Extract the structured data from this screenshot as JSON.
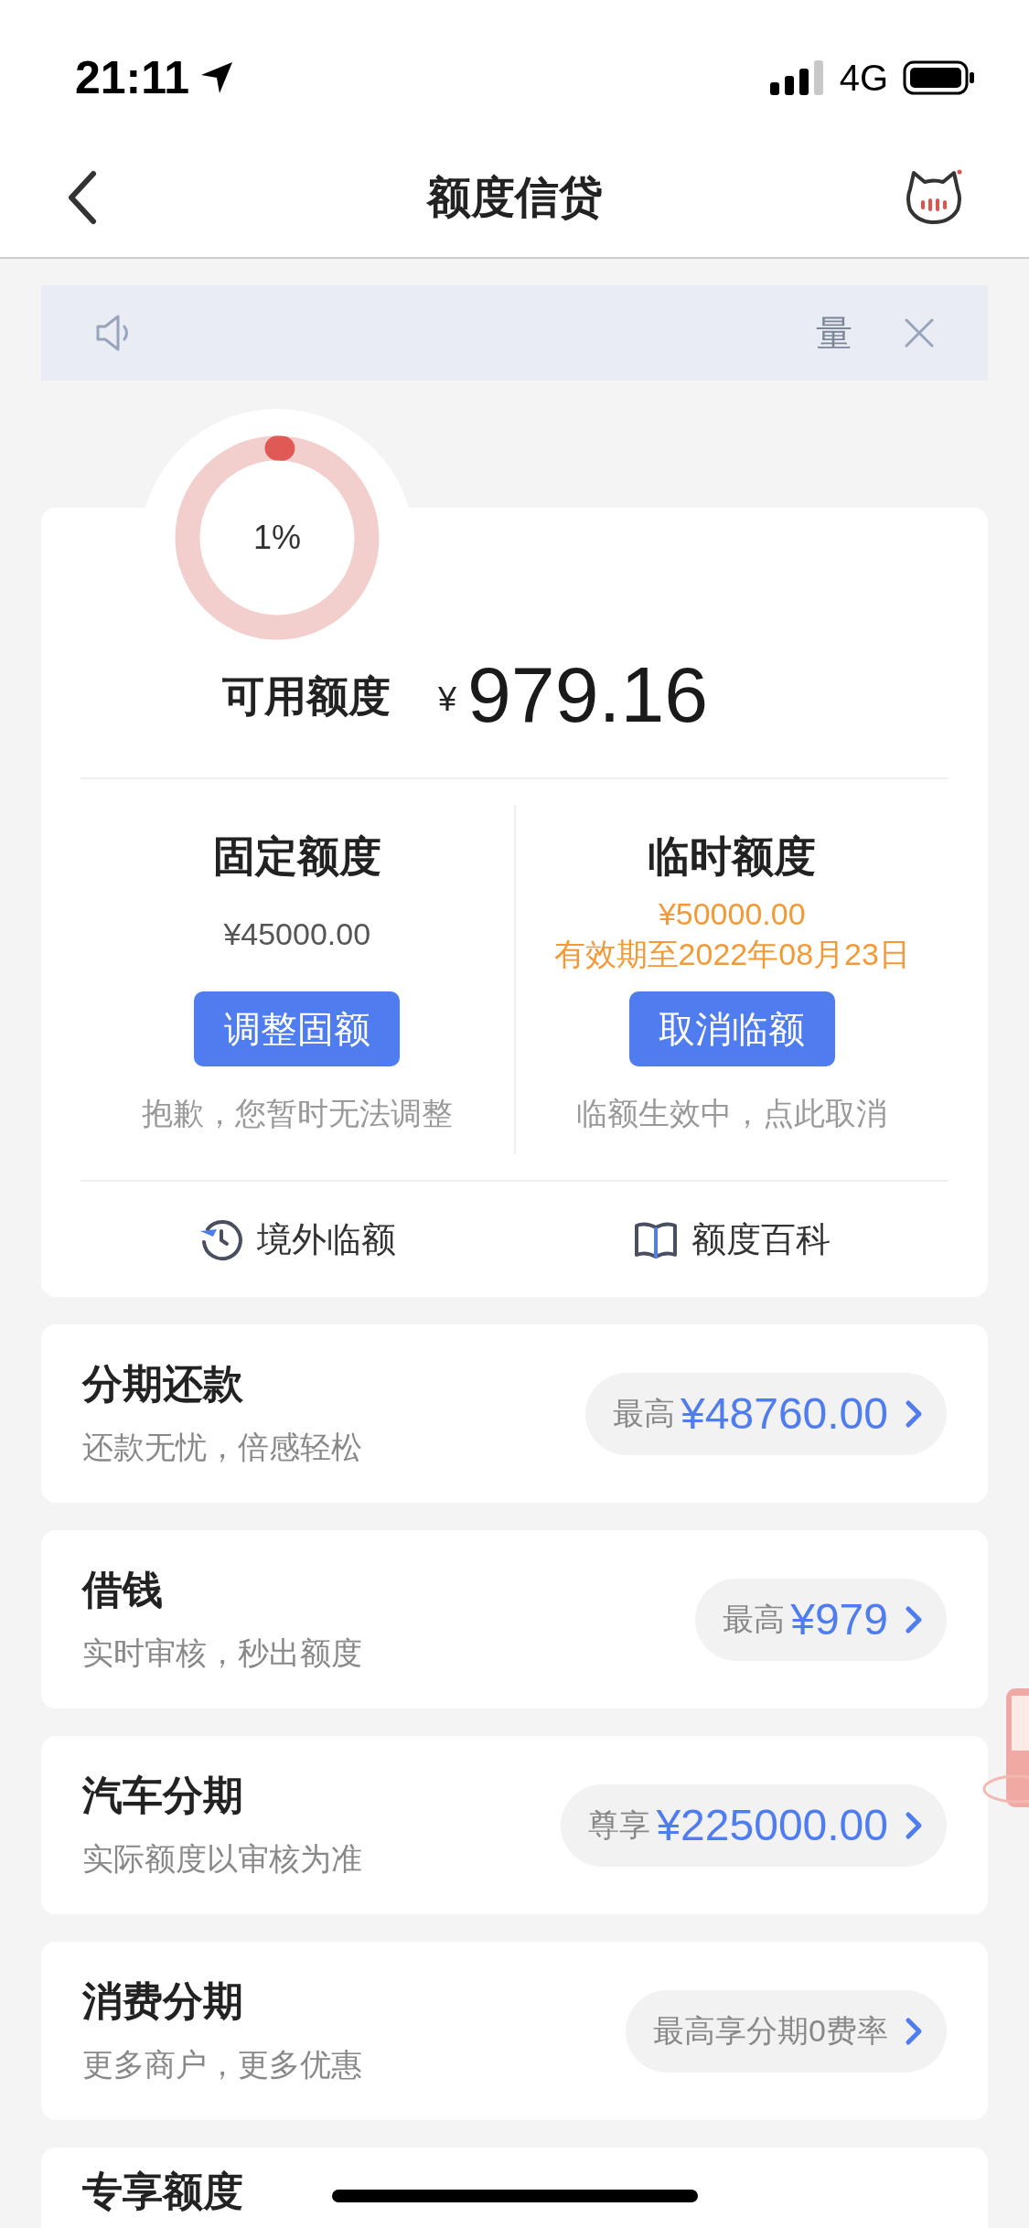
{
  "status_bar": {
    "time": "21:11",
    "network": "4G"
  },
  "nav": {
    "title": "额度信贷"
  },
  "notice": {
    "text": "量"
  },
  "credit": {
    "percent": "1%",
    "label": "可用额度",
    "currency": "¥",
    "amount": "979.16",
    "columns": [
      {
        "title": "固定额度",
        "lines": [
          {
            "text": "¥45000.00",
            "kind": "plain"
          }
        ],
        "button": "调整固额",
        "note": "抱歉，您暂时无法调整"
      },
      {
        "title": "临时额度",
        "lines": [
          {
            "text": "¥50000.00",
            "kind": "highlight"
          },
          {
            "text": "有效期至2022年08月23日",
            "kind": "highlight"
          }
        ],
        "button": "取消临额",
        "note": "临额生效中，点此取消"
      }
    ],
    "links": [
      {
        "label": "境外临额",
        "kind": "plane"
      },
      {
        "label": "额度百科",
        "kind": "book"
      }
    ]
  },
  "products": [
    {
      "title": "分期还款",
      "subtitle": "还款无忧，倍感轻松",
      "pill": {
        "prefix": "最高",
        "amount": "¥48760.00"
      }
    },
    {
      "title": "借钱",
      "subtitle": "实时审核，秒出额度",
      "pill": {
        "prefix": "最高",
        "amount": "¥979"
      }
    },
    {
      "title": "汽车分期",
      "subtitle": "实际额度以审核为准",
      "pill": {
        "prefix": "尊享",
        "amount": "¥225000.00"
      }
    },
    {
      "title": "消费分期",
      "subtitle": "更多商户，更多优惠",
      "pill": {
        "prefix": "最高享分期0费率"
      }
    },
    {
      "title": "专享额度"
    }
  ]
}
